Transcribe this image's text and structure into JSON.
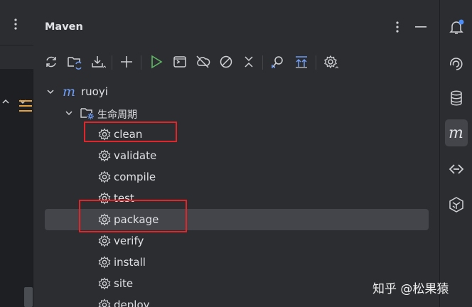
{
  "panel": {
    "title": "Maven"
  },
  "toolbar": {
    "buttons": [
      {
        "name": "reload-all-icon"
      },
      {
        "name": "reload-project-icon"
      },
      {
        "name": "download-sources-icon"
      },
      {
        "name": "add-project-icon"
      },
      {
        "name": "run-icon"
      },
      {
        "name": "execute-goal-icon"
      },
      {
        "name": "offline-mode-icon"
      },
      {
        "name": "skip-tests-icon"
      },
      {
        "name": "collapse-all-icon"
      },
      {
        "name": "analyze-deps-icon"
      },
      {
        "name": "expand-all-icon"
      },
      {
        "name": "settings-icon"
      }
    ]
  },
  "tree": {
    "project": "ruoyi",
    "lifecycle_folder": "生命周期",
    "goals": [
      "clean",
      "validate",
      "compile",
      "test",
      "package",
      "verify",
      "install",
      "site",
      "deploy"
    ],
    "selected_goal": "package"
  },
  "colors": {
    "panel_bg": "#2b2d30",
    "editor_bg": "#1e1f22",
    "selection": "#43454a",
    "annotation_red": "#e0252b",
    "run_green": "#5fb865",
    "maven_blue": "#6f9df6",
    "hamburger_orange": "#e8a33d",
    "notify_blue": "#4d8df6"
  },
  "watermark": "知乎 @松果猿"
}
